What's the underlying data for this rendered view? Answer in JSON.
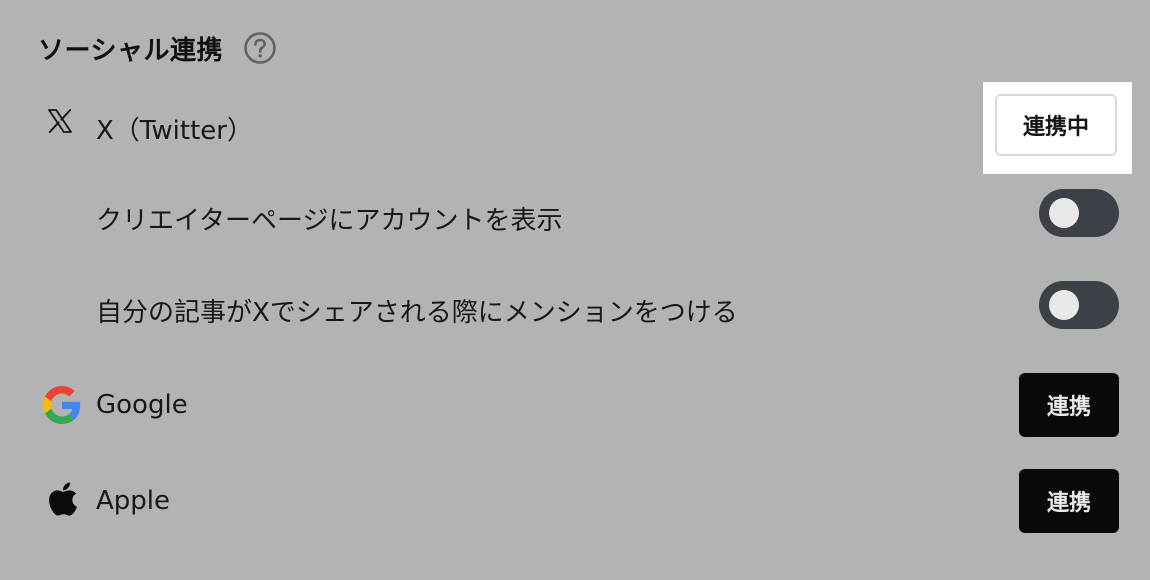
{
  "section": {
    "title": "ソーシャル連携",
    "help_icon": "question-circle-icon"
  },
  "twitter": {
    "icon": "x-logo-icon",
    "label": "X（Twitter）",
    "button_label": "連携中"
  },
  "settings": [
    {
      "label": "クリエイターページにアカウントを表示",
      "enabled": false
    },
    {
      "label": "自分の記事がXでシェアされる際にメンションをつける",
      "enabled": false
    }
  ],
  "google": {
    "icon": "google-logo-icon",
    "label": "Google",
    "button_label": "連携"
  },
  "apple": {
    "icon": "apple-logo-icon",
    "label": "Apple",
    "button_label": "連携"
  },
  "colors": {
    "background": "#b3b3b3",
    "dark_button": "#08090b",
    "toggle_off": "#3c4047",
    "highlight": "#ffffff"
  }
}
